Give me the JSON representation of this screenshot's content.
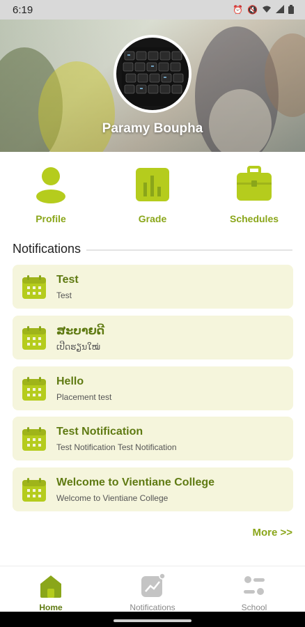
{
  "status_bar": {
    "time": "6:19"
  },
  "profile": {
    "name": "Paramy Boupha"
  },
  "quick_actions": [
    {
      "label": "Profile",
      "icon": "person-icon"
    },
    {
      "label": "Grade",
      "icon": "chart-bars-icon"
    },
    {
      "label": "Schedules",
      "icon": "briefcase-icon"
    }
  ],
  "notifications": {
    "title": "Notifications",
    "items": [
      {
        "title": "Test",
        "subtitle": "Test"
      },
      {
        "title": "ສະບາຍດີ",
        "subtitle": "ເປີດຮຽນໃໝ່"
      },
      {
        "title": "Hello",
        "subtitle": "Placement test"
      },
      {
        "title": "Test Notification",
        "subtitle": "Test Notification Test Notification"
      },
      {
        "title": "Welcome to Vientiane College",
        "subtitle": "Welcome to Vientiane College"
      }
    ],
    "more_label": "More >>"
  },
  "bottom_nav": [
    {
      "label": "Home",
      "icon": "home-icon",
      "active": true
    },
    {
      "label": "Notifications",
      "icon": "notifications-chart-icon",
      "active": false
    },
    {
      "label": "School",
      "icon": "school-icon",
      "active": false
    }
  ],
  "colors": {
    "accent": "#8aa61a",
    "accent_dark": "#5f7a12",
    "icon_fill": "#b5cc1d",
    "card_bg": "#f5f5dc"
  }
}
